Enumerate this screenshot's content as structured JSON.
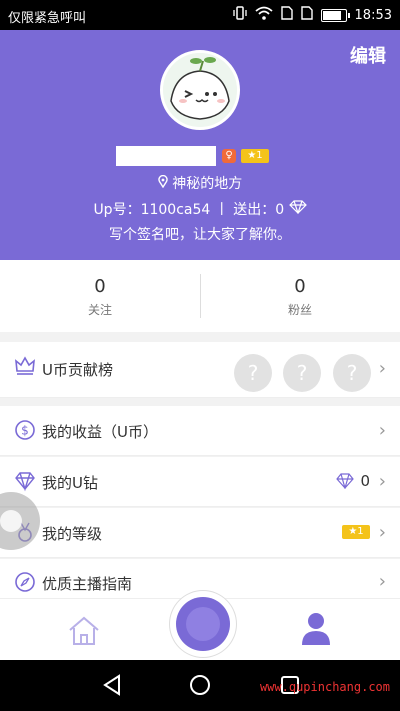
{
  "status_bar": {
    "carrier": "仅限紧急呼叫",
    "time": "18:53"
  },
  "header": {
    "edit_label": "编辑",
    "level_badge": "1",
    "location": "神秘的地方",
    "id_text": "Up号：1100ca54 丨 送出：0",
    "signature": "写个签名吧，让大家了解你。"
  },
  "stats": {
    "following": {
      "value": "0",
      "label": "关注"
    },
    "fans": {
      "value": "0",
      "label": "粉丝"
    }
  },
  "menu": {
    "contribution": "U币贡献榜",
    "earnings": "我的收益（U币）",
    "diamonds": "我的U钻",
    "diamonds_value": "0",
    "level": "我的等级",
    "level_badge": "1",
    "guide": "优质主播指南"
  },
  "navbar": {
    "watermark": "www.qupinchang.com"
  },
  "colors": {
    "accent": "#7a6ad6",
    "level_yellow": "#f4c31a",
    "gender_orange": "#f06a3a"
  }
}
